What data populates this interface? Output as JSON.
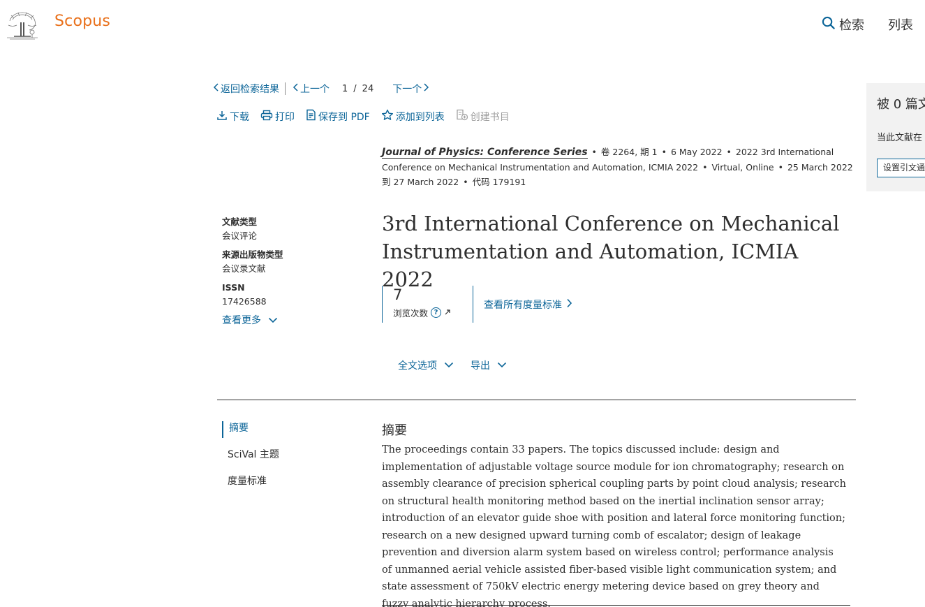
{
  "header": {
    "brand": "Scopus",
    "nav_search": "检索",
    "nav_list": "列表"
  },
  "result_nav": {
    "back": "返回检索结果",
    "prev": "上一个",
    "current": "1",
    "total": "24",
    "next": "下一个"
  },
  "toolbar": {
    "download": "下载",
    "print": "打印",
    "save_pdf": "保存到 PDF",
    "add_to_list": "添加到列表",
    "create_bib": "创建书目"
  },
  "source": {
    "journal": "Journal of Physics: Conference Series",
    "volume": "卷 2264, 期 1",
    "date": "6 May 2022",
    "conference": "2022 3rd International Conference on Mechanical Instrumentation and Automation, ICMIA 2022",
    "location": "Virtual, Online",
    "conf_dates": "25 March 2022到 27 March 2022",
    "code": "代码 179191"
  },
  "meta": {
    "doc_type_label": "文献类型",
    "doc_type_value": "会议评论",
    "source_type_label": "来源出版物类型",
    "source_type_value": "会议录文献",
    "issn_label": "ISSN",
    "issn_value": "17426588",
    "show_more": "查看更多"
  },
  "title": "3rd International Conference on Mechanical Instrumentation and Automation, ICMIA 2022",
  "metrics": {
    "views_value": "7",
    "views_label": "浏览次数",
    "all_metrics": "查看所有度量标准"
  },
  "options": {
    "fulltext": "全文选项",
    "export": "导出"
  },
  "section_nav": {
    "abstract": "摘要",
    "scival": "SciVal 主题",
    "metrics": "度量标准"
  },
  "abstract": {
    "heading": "摘要",
    "text": "The proceedings contain 33 papers. The topics discussed include: design and implementation of adjustable voltage source module for ion chromatography; research on assembly clearance of precision spherical coupling parts by point cloud analysis; research on structural health monitoring method based on the inertial inclination sensor array; introduction of an elevator guide shoe with position and lateral force monitoring function; research on a new designed upward turning comb of escalator; design of leakage prevention and diversion alarm system based on wireless control; performance analysis of unmanned aerial vehicle assisted fiber-based visible light communication system; and state assessment of 750kV electric energy metering device based on grey theory and fuzzy analytic hierarchy process."
  },
  "cite_panel": {
    "title": "被 0 篇文",
    "desc": "当此文献在",
    "alert_button": "设置引文通"
  },
  "colors": {
    "brand": "#e9711c",
    "link": "#0c6598",
    "panel_bg": "#f2f2f2"
  }
}
